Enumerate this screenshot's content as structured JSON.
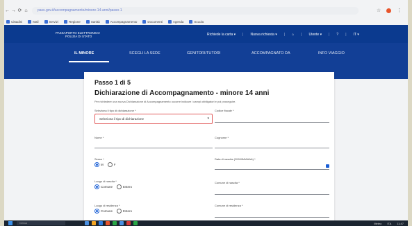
{
  "browser": {
    "url": "pass.gov.it/accompagnamento/minore-14-anni/passo-1",
    "nav_icons": [
      "←",
      "→",
      "⟳",
      "⌂"
    ],
    "right_icons": [
      "☆",
      "⋮"
    ]
  },
  "bookmarks": [
    "Cittadini",
    "Mail",
    "Servizi",
    "Regione",
    "Sanità",
    "Accompagnamento",
    "Documenti",
    "Agenda",
    "Scuola"
  ],
  "header": {
    "logo": "PASSAPORTO ELETTRONICO",
    "logo_sub": "POLIZIA DI STATO",
    "menu": [
      "Richiede la carta  ▾",
      "Nuova richiesta  ▾",
      "⌂",
      "Utente  ▾",
      "?",
      "IT ▾"
    ]
  },
  "subnav": [
    "IL MINORE",
    "SCEGLI LA SEDE",
    "GENITORI/TUTORI",
    "ACCOMPAGNATO DA",
    "INFO VIAGGIO"
  ],
  "form": {
    "step": "Passo 1 di 5",
    "title": "Dichiarazione di Accompagnamento - minore 14 anni",
    "description": "Per richiedere una nuova Dichiarazione di Accompagnamento occorre indicare i campi obbligatori e poi proseguire.",
    "select_label": "Seleziona il tipo di dichiarazione *",
    "select_value": "Seleziona il tipo di dichiarazione",
    "codice_fiscale_label": "Codice fiscale *",
    "nome_label": "Nome *",
    "cognome_label": "Cognome *",
    "sesso_label": "Sesso *",
    "sesso_m": "M",
    "sesso_f": "F",
    "data_nascita_label": "Data di nascita (GG/MM/AAAA) *",
    "luogo_nascita_label": "Luogo di nascita *",
    "luogo_nascita_opt1": "Comune",
    "luogo_nascita_opt2": "Estero",
    "comune_nascita_label": "Comune di nascita *",
    "luogo_residenza_label": "Luogo di residenza *",
    "luogo_residenza_opt1": "Comune",
    "luogo_residenza_opt2": "Estero",
    "comune_residenza_label": "Comune di residenza *"
  },
  "taskbar": {
    "search": "Cerca",
    "right": [
      "Meteo",
      "ITA",
      "11:47"
    ]
  },
  "colors": {
    "header": "#0b3a8f",
    "subnav": "#123f96",
    "accent": "#1a5fd6",
    "error_border": "#e15b5b"
  }
}
